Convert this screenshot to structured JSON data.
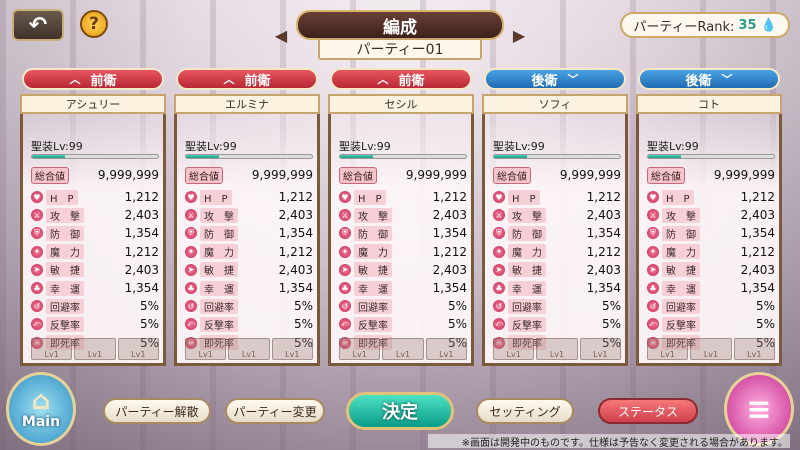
{
  "header": {
    "back_icon": "back-arrow-icon",
    "help_label": "?",
    "title": "編成",
    "party_name": "パーティー01",
    "rank_label": "パーティーRank:",
    "rank_value": "35"
  },
  "cards": [
    {
      "position": "前衛",
      "position_type": "front",
      "name": "アシュリー",
      "level": "聖装Lv:99",
      "level_fraction": 0.26,
      "total_label": "総合値",
      "total": "9,999,999",
      "stats": [
        {
          "label": "H　P",
          "value": "1,212"
        },
        {
          "label": "攻　撃",
          "value": "2,403"
        },
        {
          "label": "防　御",
          "value": "1,354"
        },
        {
          "label": "魔　力",
          "value": "1,212"
        },
        {
          "label": "敏　捷",
          "value": "2,403"
        },
        {
          "label": "幸　運",
          "value": "1,354"
        },
        {
          "label": "回避率",
          "value": "5%"
        },
        {
          "label": "反撃率",
          "value": "5%"
        },
        {
          "label": "即死率",
          "value": "5%"
        }
      ]
    },
    {
      "position": "前衛",
      "position_type": "front",
      "name": "エルミナ",
      "level": "聖装Lv:99",
      "level_fraction": 0.26,
      "total_label": "総合値",
      "total": "9,999,999",
      "stats": [
        {
          "label": "H　P",
          "value": "1,212"
        },
        {
          "label": "攻　撃",
          "value": "2,403"
        },
        {
          "label": "防　御",
          "value": "1,354"
        },
        {
          "label": "魔　力",
          "value": "1,212"
        },
        {
          "label": "敏　捷",
          "value": "2,403"
        },
        {
          "label": "幸　運",
          "value": "1,354"
        },
        {
          "label": "回避率",
          "value": "5%"
        },
        {
          "label": "反撃率",
          "value": "5%"
        },
        {
          "label": "即死率",
          "value": "5%"
        }
      ]
    },
    {
      "position": "前衛",
      "position_type": "front",
      "name": "セシル",
      "level": "聖装Lv:99",
      "level_fraction": 0.26,
      "total_label": "総合値",
      "total": "9,999,999",
      "stats": [
        {
          "label": "H　P",
          "value": "1,212"
        },
        {
          "label": "攻　撃",
          "value": "2,403"
        },
        {
          "label": "防　御",
          "value": "1,354"
        },
        {
          "label": "魔　力",
          "value": "1,212"
        },
        {
          "label": "敏　捷",
          "value": "2,403"
        },
        {
          "label": "幸　運",
          "value": "1,354"
        },
        {
          "label": "回避率",
          "value": "5%"
        },
        {
          "label": "反撃率",
          "value": "5%"
        },
        {
          "label": "即死率",
          "value": "5%"
        }
      ]
    },
    {
      "position": "後衛",
      "position_type": "back",
      "name": "ソフィ",
      "level": "聖装Lv:99",
      "level_fraction": 0.26,
      "total_label": "総合値",
      "total": "9,999,999",
      "stats": [
        {
          "label": "H　P",
          "value": "1,212"
        },
        {
          "label": "攻　撃",
          "value": "2,403"
        },
        {
          "label": "防　御",
          "value": "1,354"
        },
        {
          "label": "魔　力",
          "value": "1,212"
        },
        {
          "label": "敏　捷",
          "value": "2,403"
        },
        {
          "label": "幸　運",
          "value": "1,354"
        },
        {
          "label": "回避率",
          "value": "5%"
        },
        {
          "label": "反撃率",
          "value": "5%"
        },
        {
          "label": "即死率",
          "value": "5%"
        }
      ]
    },
    {
      "position": "後衛",
      "position_type": "back",
      "name": "コト",
      "level": "聖装Lv:99",
      "level_fraction": 0.26,
      "total_label": "総合値",
      "total": "9,999,999",
      "stats": [
        {
          "label": "H　P",
          "value": "1,212"
        },
        {
          "label": "攻　撃",
          "value": "2,403"
        },
        {
          "label": "防　御",
          "value": "1,354"
        },
        {
          "label": "魔　力",
          "value": "1,212"
        },
        {
          "label": "敏　捷",
          "value": "2,403"
        },
        {
          "label": "幸　運",
          "value": "1,354"
        },
        {
          "label": "回避率",
          "value": "5%"
        },
        {
          "label": "反撃率",
          "value": "5%"
        },
        {
          "label": "即死率",
          "value": "5%"
        }
      ]
    }
  ],
  "hint_cells": [
    "Lv1",
    "Lv1",
    "Lv1"
  ],
  "bottom": {
    "main_label": "Main",
    "disband_label": "パーティー解散",
    "change_label": "パーティー変更",
    "decide_label": "決定",
    "setting_label": "セッティング",
    "status_label": "ステータス",
    "menu_icon": "hamburger-menu-icon",
    "notice": "※画面は開発中のものです。仕様は予告なく変更される場合があります。"
  },
  "colors": {
    "front": "#d0404f",
    "back": "#2f7fc9",
    "decide": "#0c9c8a",
    "rank_value": "#2a9c8c"
  }
}
